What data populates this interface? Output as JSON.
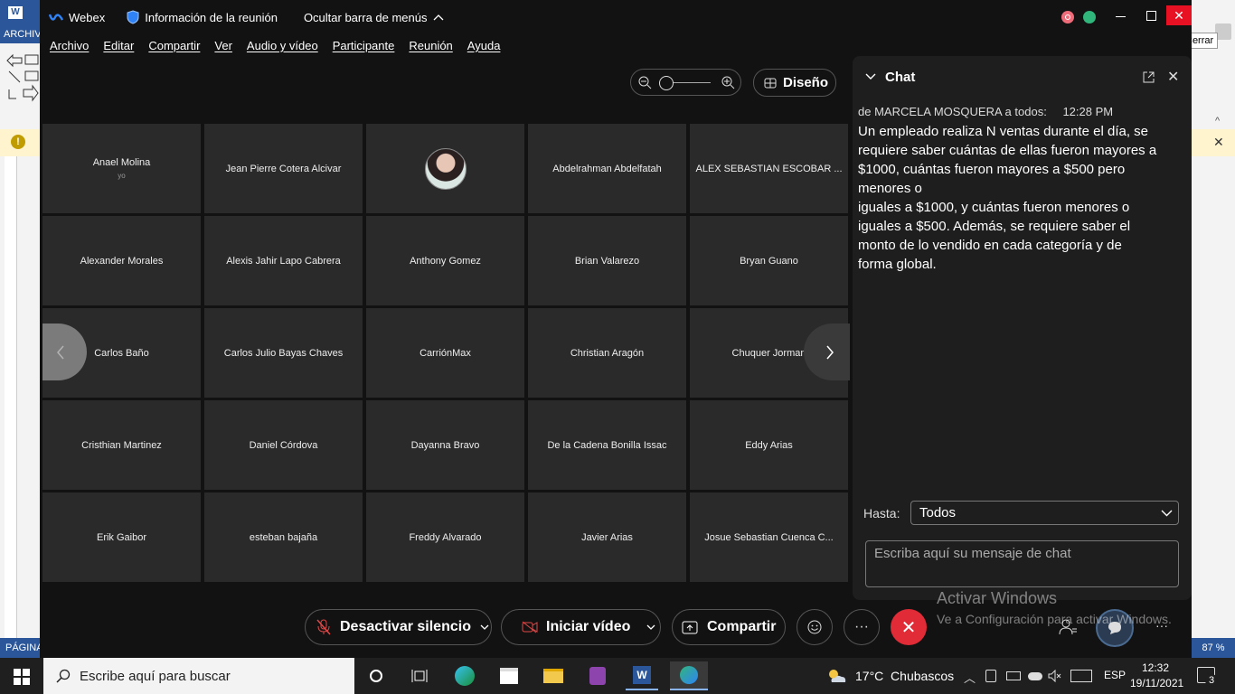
{
  "word_bg": {
    "ribbon_label": "ARCHIV",
    "status_left": "PÁGINA",
    "zoom": "87 %",
    "tooltip_close": "Cerrar"
  },
  "titlebar": {
    "app_name": "Webex",
    "meeting_info": "Información de la reunión",
    "hide_menu": "Ocultar barra de menús"
  },
  "menu": [
    "Archivo",
    "Editar",
    "Compartir",
    "Ver",
    "Audio y vídeo",
    "Participante",
    "Reunión",
    "Ayuda"
  ],
  "toolbar": {
    "layout_label": "Diseño"
  },
  "participants": [
    {
      "name": "Anael Molina",
      "sub": "yo"
    },
    {
      "name": "Jean Pierre Cotera Alcivar"
    },
    {
      "name": "",
      "avatar": true
    },
    {
      "name": "Abdelrahman Abdelfatah"
    },
    {
      "name": "ALEX SEBASTIAN ESCOBAR ..."
    },
    {
      "name": "Alexander Morales"
    },
    {
      "name": "Alexis Jahir Lapo Cabrera"
    },
    {
      "name": "Anthony Gomez"
    },
    {
      "name": "Brian Valarezo"
    },
    {
      "name": "Bryan Guano"
    },
    {
      "name": "Carlos Baño"
    },
    {
      "name": "Carlos Julio Bayas Chaves"
    },
    {
      "name": "CarriónMax"
    },
    {
      "name": "Christian Aragón"
    },
    {
      "name": "Chuquer Jorman"
    },
    {
      "name": "Cristhian Martinez"
    },
    {
      "name": "Daniel Córdova"
    },
    {
      "name": "Dayanna Bravo"
    },
    {
      "name": "De la Cadena Bonilla Issac"
    },
    {
      "name": "Eddy Arias"
    },
    {
      "name": "Erik Gaibor"
    },
    {
      "name": "esteban bajaña"
    },
    {
      "name": "Freddy Alvarado"
    },
    {
      "name": "Javier Arias"
    },
    {
      "name": "Josue Sebastian Cuenca C..."
    }
  ],
  "chat": {
    "title": "Chat",
    "sender": "de MARCELA MOSQUERA a todos:",
    "time": "12:28 PM",
    "message_lines": [
      "Un empleado realiza N ventas durante el día, se",
      "requiere saber cuántas de ellas fueron mayores a",
      "$1000, cuántas fueron mayores a $500 pero",
      "menores o",
      "iguales a $1000, y cuántas fueron menores o",
      "iguales a $500. Además, se requiere saber el",
      "monto de lo vendido en cada categoría y de",
      "forma global."
    ],
    "to_label": "Hasta:",
    "to_value": "Todos",
    "input_placeholder": "Escriba aquí su mensaje de chat"
  },
  "controls": {
    "mute": "Desactivar silencio",
    "video": "Iniciar vídeo",
    "share": "Compartir",
    "more": "···"
  },
  "watermark": {
    "line1": "Activar Windows",
    "line2": "Ve a Configuración para activar Windows."
  },
  "taskbar": {
    "search_placeholder": "Escribe aquí para buscar",
    "weather": "17°C  Chubascos",
    "lang": "ESP",
    "time": "12:32",
    "date": "19/11/2021",
    "notif_count": "3"
  },
  "colors": {
    "end_call": "#e12b36",
    "accent": "#2b579a"
  }
}
